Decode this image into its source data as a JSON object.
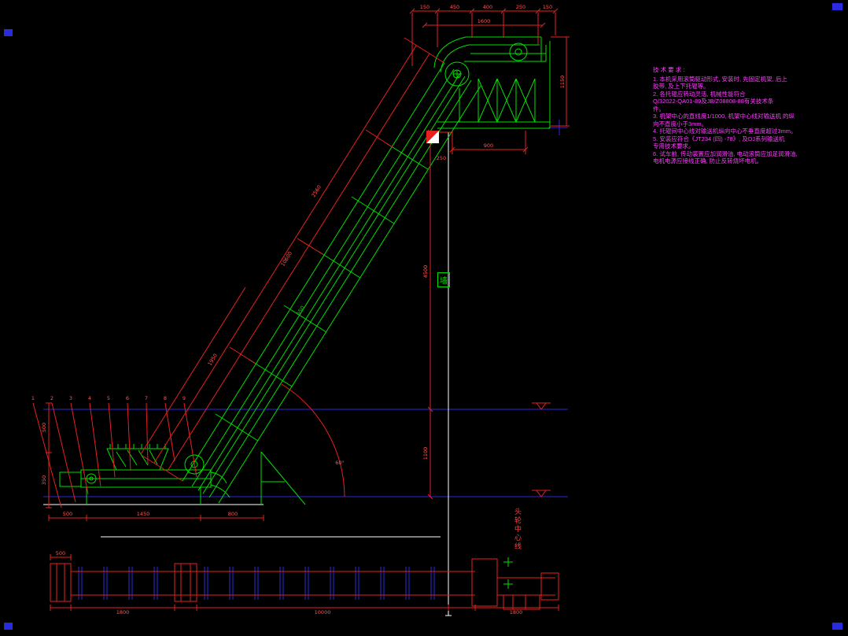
{
  "notes": {
    "title": "技 术 要 求 :",
    "lines": [
      "1. 本机采用滚筒驱动形式, 安装时, 先固定机架, 后上",
      "胶带, 及上下托辊等。",
      "2. 各托辊应转动灵活, 机械性能符合",
      "Q/32022-QA01-89及JB/Z08808-88有关技术条",
      "件。",
      "3. 机架中心的直线度1/1000, 机架中心线对输送机 的纵",
      "向不直度小于3mm。",
      "4. 托辊间中心线对输送机纵向中心不垂直度超过3mm。",
      "5. 安装应符合《JT234 (四) -78》, 及DJ系列输送机",
      "专用技术要求。",
      "6. 试车前, 传动装置应加润滑油, 电动滚筒应加足润滑油,",
      "电机电源应接线正确, 防止反转烧坏电机。"
    ]
  },
  "labels": {
    "wall": "墙",
    "centerline": "头轮中心线"
  },
  "dims": {
    "top_chain": [
      "150",
      "450",
      "400",
      "250",
      "150"
    ],
    "top_overall": "1600",
    "head_width": "900",
    "wall_gap": "250",
    "head_height": "1150",
    "drop_height": "4500",
    "floor_gap": "1100",
    "incline_length": "10600",
    "incline_seg1": "1950",
    "incline_seg2": "2560",
    "belt_width": "650",
    "angle": "60°",
    "tail_chain": [
      "500",
      "1450",
      "800"
    ],
    "left_chain": [
      "500",
      "350"
    ],
    "plan_chain": [
      "1800",
      "10000",
      "1800"
    ],
    "plan_left_offset": "500"
  },
  "callouts": [
    "1",
    "2",
    "3",
    "4",
    "5",
    "6",
    "7",
    "8",
    "9"
  ]
}
